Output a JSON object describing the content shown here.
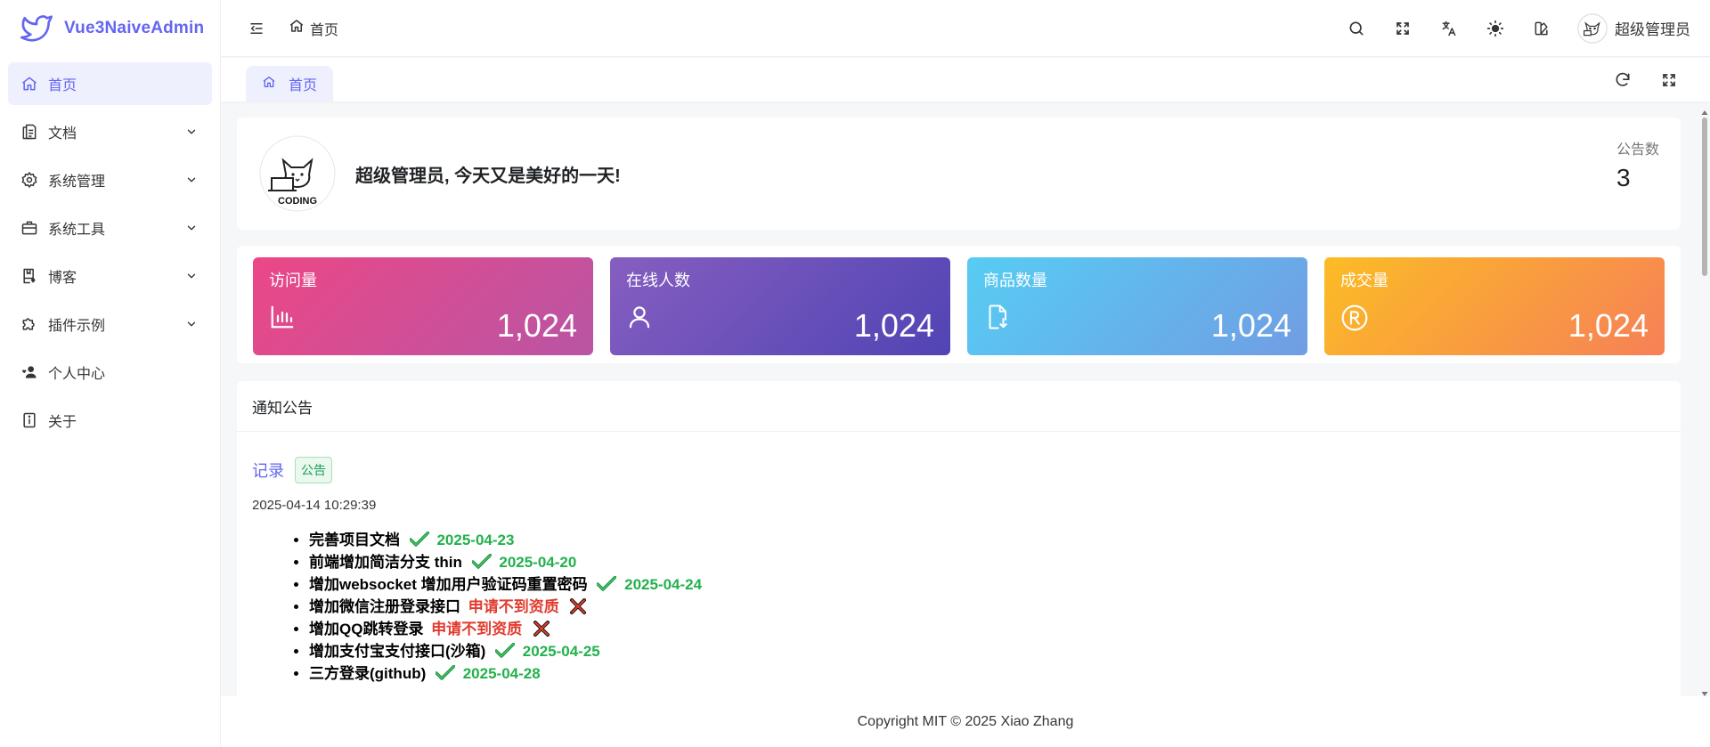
{
  "app": {
    "title": "Vue3NaiveAdmin",
    "brand_color": "#6366f1"
  },
  "sidebar": {
    "items": [
      {
        "label": "首页",
        "icon": "home-icon",
        "active": true
      },
      {
        "label": "文档",
        "icon": "document-icon",
        "expandable": true
      },
      {
        "label": "系统管理",
        "icon": "gear-icon",
        "expandable": true
      },
      {
        "label": "系统工具",
        "icon": "toolbox-icon",
        "expandable": true
      },
      {
        "label": "博客",
        "icon": "blog-icon",
        "expandable": true
      },
      {
        "label": "插件示例",
        "icon": "puzzle-icon",
        "expandable": true
      },
      {
        "label": "个人中心",
        "icon": "user-heart-icon"
      },
      {
        "label": "关于",
        "icon": "info-icon"
      }
    ]
  },
  "header": {
    "breadcrumb": "首页",
    "actions": [
      "search-icon",
      "fullscreen-icon",
      "translate-icon",
      "theme-sun-icon",
      "theme-palette-icon"
    ],
    "user_name": "超级管理员"
  },
  "tabs": {
    "items": [
      {
        "label": "首页"
      }
    ],
    "actions": [
      "refresh-icon",
      "fullscreen-icon"
    ]
  },
  "welcome": {
    "avatar_caption": "CODING",
    "greeting": "超级管理员, 今天又是美好的一天!",
    "notice_count_label": "公告数",
    "notice_count": "3"
  },
  "stats": [
    {
      "label": "访问量",
      "value": "1,024",
      "icon": "bar-chart-icon",
      "color": "#ec4786"
    },
    {
      "label": "在线人数",
      "value": "1,024",
      "icon": "user-icon",
      "color": "#865ec0"
    },
    {
      "label": "商品数量",
      "value": "1,024",
      "icon": "file-download-icon",
      "color": "#56cdf3"
    },
    {
      "label": "成交量",
      "value": "1,024",
      "icon": "registered-icon",
      "color": "#fcbc25"
    }
  ],
  "notice": {
    "title": "通知公告",
    "record_link": "记录",
    "tag": "公告",
    "time": "2025-04-14 10:29:39",
    "items": [
      {
        "text": "完善项目文档",
        "status": "done",
        "note": "2025-04-23"
      },
      {
        "text": "前端增加简洁分支 thin",
        "status": "done",
        "note": "2025-04-20"
      },
      {
        "text": "增加websocket 增加用户验证码重置密码",
        "status": "done",
        "note": "2025-04-24"
      },
      {
        "text": "增加微信注册登录接口",
        "status": "failed",
        "note": "申请不到资质"
      },
      {
        "text": "增加QQ跳转登录",
        "status": "failed",
        "note": "申请不到资质"
      },
      {
        "text": "增加支付宝支付接口(沙箱)",
        "status": "done",
        "note": "2025-04-25"
      },
      {
        "text": "三方登录(github)",
        "status": "done",
        "note": "2025-04-28"
      }
    ]
  },
  "footer": {
    "text": "Copyright MIT © 2025 Xiao Zhang"
  }
}
